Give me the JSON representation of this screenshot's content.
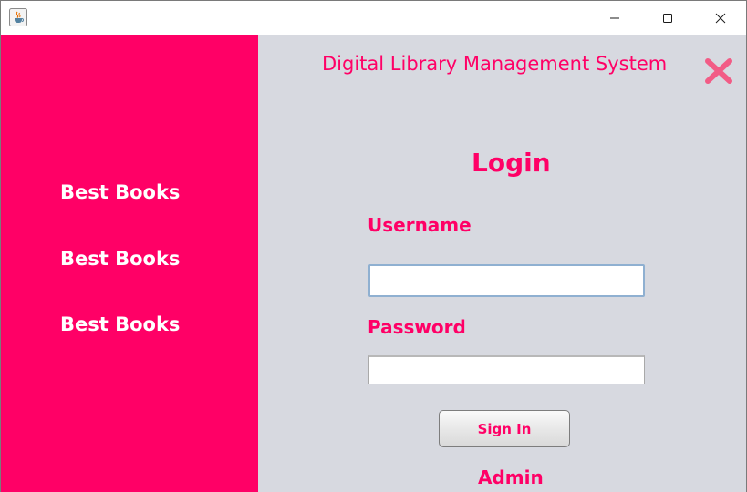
{
  "window": {
    "icon": "java-coffee-cup-icon",
    "controls": [
      "minimize-icon",
      "maximize-icon",
      "close-icon"
    ]
  },
  "sidebar": {
    "background": "#ff0066",
    "items": [
      {
        "label": "Best Books"
      },
      {
        "label": "Best Books"
      },
      {
        "label": "Best Books"
      }
    ]
  },
  "main": {
    "background": "#d7d9e0",
    "accent": "#ff0066",
    "app_title": "Digital Library Management System",
    "close_icon": "close-x-icon",
    "login_title": "Login",
    "username": {
      "label": "Username",
      "value": ""
    },
    "password": {
      "label": "Password",
      "value": ""
    },
    "signin_label": "Sign In",
    "admin_label": "Admin"
  }
}
